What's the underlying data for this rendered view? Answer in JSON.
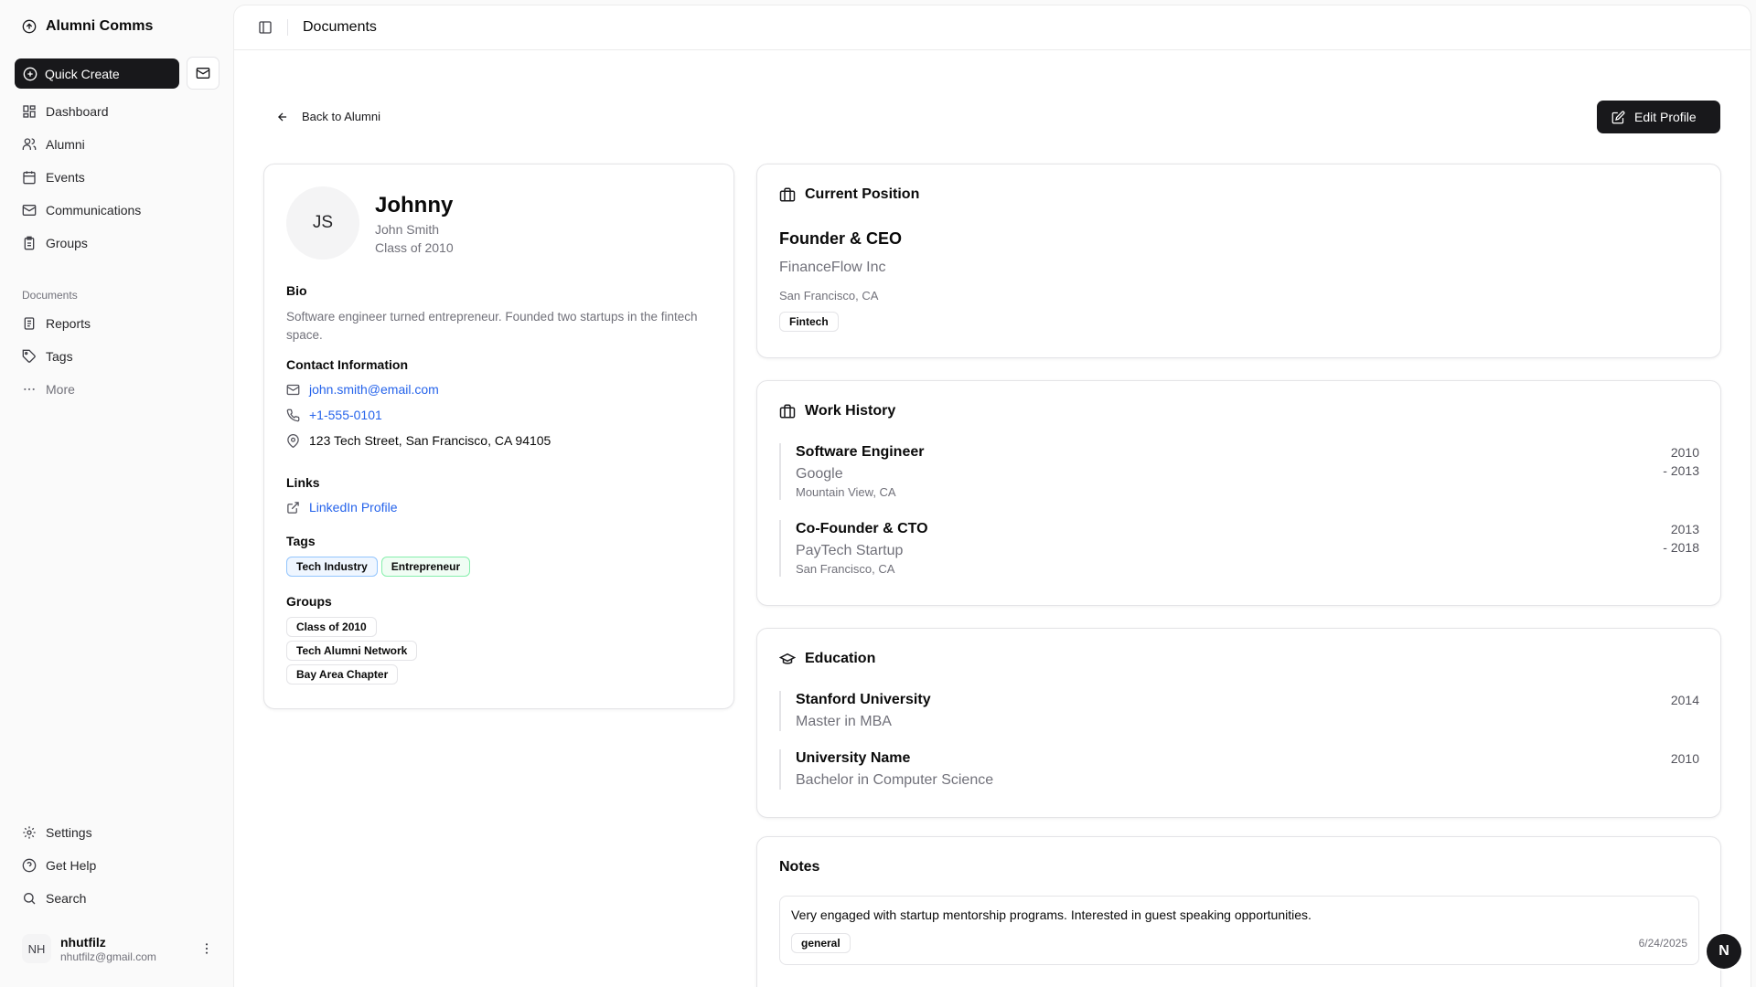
{
  "brand": {
    "name": "Alumni Comms"
  },
  "sidebar": {
    "quick_create": "Quick Create",
    "nav": [
      "Dashboard",
      "Alumni",
      "Events",
      "Communications",
      "Groups"
    ],
    "documents_label": "Documents",
    "doc_items": [
      "Reports",
      "Tags",
      "More"
    ],
    "bottom": [
      "Settings",
      "Get Help",
      "Search"
    ],
    "user": {
      "initials": "NH",
      "name": "nhutfilz",
      "email": "nhutfilz@gmail.com"
    }
  },
  "topbar": {
    "title": "Documents"
  },
  "page": {
    "back_label": "Back to Alumni",
    "edit_label": "Edit Profile"
  },
  "profile": {
    "initials": "JS",
    "name": "Johnny",
    "full_name": "John Smith",
    "class_of": "Class of 2010",
    "bio_label": "Bio",
    "bio": "Software engineer turned entrepreneur. Founded two startups in the fintech space.",
    "contact_label": "Contact Information",
    "email": "john.smith@email.com",
    "phone": "+1-555-0101",
    "address": "123 Tech Street, San Francisco, CA 94105",
    "links_label": "Links",
    "linkedin": "LinkedIn Profile",
    "tags_label": "Tags",
    "tags": [
      "Tech Industry",
      "Entrepreneur"
    ],
    "groups_label": "Groups",
    "groups": [
      "Class of 2010",
      "Tech Alumni Network",
      "Bay Area Chapter"
    ]
  },
  "position": {
    "heading": "Current Position",
    "title": "Founder & CEO",
    "company": "FinanceFlow Inc",
    "location": "San Francisco, CA",
    "industry": "Fintech"
  },
  "work_history": {
    "heading": "Work History",
    "items": [
      {
        "title": "Software Engineer",
        "company": "Google",
        "location": "Mountain View, CA",
        "start": "2010",
        "end": "- 2013"
      },
      {
        "title": "Co-Founder & CTO",
        "company": "PayTech Startup",
        "location": "San Francisco, CA",
        "start": "2013",
        "end": "- 2018"
      }
    ]
  },
  "education": {
    "heading": "Education",
    "items": [
      {
        "school": "Stanford University",
        "degree": "Master in MBA",
        "year": "2014"
      },
      {
        "school": "University Name",
        "degree": "Bachelor in Computer Science",
        "year": "2010"
      }
    ]
  },
  "notes": {
    "heading": "Notes",
    "items": [
      {
        "text": "Very engaged with startup mentorship programs. Interested in guest speaking opportunities.",
        "tag": "general",
        "date": "6/24/2025"
      }
    ]
  },
  "fab": {
    "letter": "N"
  },
  "colors": {
    "primary": "#18181b",
    "link": "#2563eb",
    "tag_blue_bg": "#eff6ff",
    "tag_blue_border": "#93c5fd",
    "tag_green_bg": "#f0fdf4",
    "tag_green_border": "#86efac"
  }
}
